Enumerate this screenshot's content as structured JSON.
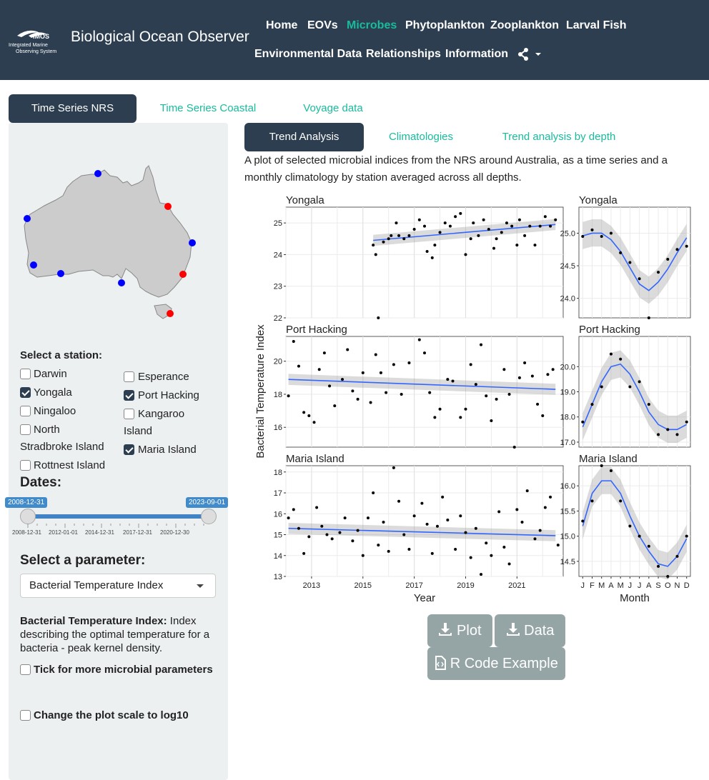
{
  "nav": {
    "brand": "Biological Ocean Observer",
    "logo_text": "IMOS",
    "logo_sub1": "Integrated Marine",
    "logo_sub2": "Observing System",
    "links": [
      "Home",
      "EOVs",
      "Microbes",
      "Phytoplankton",
      "Zooplankton",
      "Larval Fish",
      "Environmental Data",
      "Relationships",
      "Information"
    ],
    "active": "Microbes"
  },
  "top_tabs": [
    "Time Series NRS",
    "Time Series Coastal",
    "Voyage data"
  ],
  "sub_tabs": [
    "Trend Analysis",
    "Climatologies",
    "Trend analysis by depth"
  ],
  "description": "A plot of selected microbial indices from the NRS around Australia, as a time series and a monthly climatology by station averaged across all depths.",
  "sidebar": {
    "station_label": "Select a station:",
    "stations": [
      {
        "name": "Darwin",
        "checked": false
      },
      {
        "name": "Yongala",
        "checked": true
      },
      {
        "name": "Ningaloo",
        "checked": false
      },
      {
        "name": "North Stradbroke Island",
        "checked": false
      },
      {
        "name": "Rottnest Island",
        "checked": false
      },
      {
        "name": "Esperance",
        "checked": false
      },
      {
        "name": "Port Hacking",
        "checked": true
      },
      {
        "name": "Kangaroo Island",
        "checked": false
      },
      {
        "name": "Maria Island",
        "checked": true
      }
    ],
    "dates_label": "Dates:",
    "date_from": "2008-12-31",
    "date_to": "2023-09-01",
    "date_ticks": [
      "2008-12-31",
      "2012-01-01",
      "2014-12-31",
      "2017-12-31",
      "2020-12-30"
    ],
    "param_label": "Select a parameter:",
    "param_value": "Bacterial Temperature Index",
    "param_desc_term": "Bacterial Temperature Index:",
    "param_desc_text": " Index describing the optimal temperature for a bacteria - peak kernel density.",
    "tick_more_label": "Tick for more microbial parameters",
    "log_label": "Change the plot scale to log10"
  },
  "buttons": {
    "plot": "Plot",
    "data": "Data",
    "rcode": "R Code Example"
  },
  "colors": {
    "navbar": "#2c3e50",
    "accent": "#18bc9c",
    "trend": "#3366ff",
    "map_selected": "#ff0000",
    "map_unselected": "#0000ff"
  },
  "chart_data": [
    {
      "type": "scatter",
      "title": "Yongala",
      "xlabel": "Year",
      "ylabel": "Bacterial Temperature Index",
      "xlim": [
        2012,
        2022.8
      ],
      "ylim": [
        22,
        25.5
      ],
      "xticks": [
        2013,
        2015,
        2017,
        2019,
        2021
      ],
      "yticks": [
        22,
        23,
        24,
        25
      ],
      "points": [
        [
          2015.4,
          24.3
        ],
        [
          2015.5,
          24.0
        ],
        [
          2015.6,
          22.0
        ],
        [
          2015.8,
          24.4
        ],
        [
          2016.0,
          24.5
        ],
        [
          2016.1,
          24.6
        ],
        [
          2016.3,
          25.0
        ],
        [
          2016.4,
          24.6
        ],
        [
          2016.6,
          24.5
        ],
        [
          2016.8,
          24.6
        ],
        [
          2017.0,
          24.8
        ],
        [
          2017.2,
          25.1
        ],
        [
          2017.4,
          24.9
        ],
        [
          2017.5,
          24.1
        ],
        [
          2017.7,
          23.9
        ],
        [
          2017.8,
          24.3
        ],
        [
          2018.0,
          24.7
        ],
        [
          2018.2,
          25.0
        ],
        [
          2018.4,
          24.9
        ],
        [
          2018.6,
          25.2
        ],
        [
          2018.8,
          25.3
        ],
        [
          2019.0,
          24.0
        ],
        [
          2019.2,
          24.5
        ],
        [
          2019.3,
          25.0
        ],
        [
          2019.5,
          24.6
        ],
        [
          2019.7,
          25.1
        ],
        [
          2019.9,
          24.8
        ],
        [
          2020.1,
          24.2
        ],
        [
          2020.2,
          24.5
        ],
        [
          2020.4,
          24.7
        ],
        [
          2020.6,
          25.0
        ],
        [
          2020.8,
          24.9
        ],
        [
          2021.0,
          24.3
        ],
        [
          2021.1,
          25.1
        ],
        [
          2021.3,
          24.6
        ],
        [
          2021.5,
          24.9
        ],
        [
          2021.7,
          24.3
        ],
        [
          2021.9,
          24.9
        ],
        [
          2022.1,
          25.2
        ],
        [
          2022.3,
          24.9
        ],
        [
          2022.5,
          25.1
        ]
      ],
      "trend": [
        [
          2015.4,
          24.45
        ],
        [
          2022.5,
          24.95
        ]
      ]
    },
    {
      "type": "scatter",
      "title": "Port Hacking",
      "xlim": [
        2012,
        2022.8
      ],
      "ylim": [
        14.8,
        21.5
      ],
      "xticks": [
        2013,
        2015,
        2017,
        2019,
        2021
      ],
      "yticks": [
        16,
        18,
        20
      ],
      "points": [
        [
          2012.1,
          17.9
        ],
        [
          2012.3,
          21.2
        ],
        [
          2012.5,
          19.7
        ],
        [
          2012.7,
          16.9
        ],
        [
          2012.9,
          16.7
        ],
        [
          2013.1,
          16.3
        ],
        [
          2013.3,
          19.5
        ],
        [
          2013.5,
          20.5
        ],
        [
          2013.7,
          18.5
        ],
        [
          2013.9,
          17.3
        ],
        [
          2014.2,
          18.9
        ],
        [
          2014.4,
          20.7
        ],
        [
          2014.6,
          18.2
        ],
        [
          2014.8,
          17.7
        ],
        [
          2015.0,
          19.3
        ],
        [
          2015.3,
          17.5
        ],
        [
          2015.5,
          20.4
        ],
        [
          2015.7,
          19.3
        ],
        [
          2015.9,
          18.1
        ],
        [
          2016.2,
          19.8
        ],
        [
          2016.5,
          18.0
        ],
        [
          2016.8,
          19.9
        ],
        [
          2017.2,
          21.3
        ],
        [
          2017.4,
          20.5
        ],
        [
          2017.6,
          18.1
        ],
        [
          2017.8,
          16.6
        ],
        [
          2018.0,
          17.1
        ],
        [
          2018.3,
          18.9
        ],
        [
          2018.5,
          18.8
        ],
        [
          2018.8,
          16.6
        ],
        [
          2019.0,
          17.1
        ],
        [
          2019.2,
          19.8
        ],
        [
          2019.4,
          18.6
        ],
        [
          2019.6,
          21.0
        ],
        [
          2019.8,
          17.9
        ],
        [
          2020.0,
          16.4
        ],
        [
          2020.2,
          17.7
        ],
        [
          2020.5,
          19.5
        ],
        [
          2020.7,
          18.0
        ],
        [
          2020.9,
          14.8
        ],
        [
          2021.1,
          19.0
        ],
        [
          2021.3,
          19.9
        ],
        [
          2021.6,
          19.1
        ],
        [
          2021.8,
          17.4
        ],
        [
          2022.0,
          16.7
        ],
        [
          2022.2,
          19.2
        ],
        [
          2022.4,
          19.5
        ]
      ],
      "trend": [
        [
          2012.1,
          18.9
        ],
        [
          2022.5,
          18.3
        ]
      ]
    },
    {
      "type": "scatter",
      "title": "Maria Island",
      "xlim": [
        2012,
        2022.8
      ],
      "ylim": [
        13,
        18.3
      ],
      "xticks": [
        2013,
        2015,
        2017,
        2019,
        2021
      ],
      "yticks": [
        13,
        14,
        15,
        16,
        17,
        18
      ],
      "xticklabels": [
        "2013",
        "2015",
        "2017",
        "2019",
        "2021"
      ],
      "points": [
        [
          2012.1,
          15.8
        ],
        [
          2012.3,
          16.2
        ],
        [
          2012.5,
          15.3
        ],
        [
          2012.7,
          14.1
        ],
        [
          2012.9,
          14.9
        ],
        [
          2013.2,
          16.3
        ],
        [
          2013.4,
          15.4
        ],
        [
          2013.6,
          15.0
        ],
        [
          2013.8,
          14.8
        ],
        [
          2014.1,
          15.1
        ],
        [
          2014.3,
          15.8
        ],
        [
          2014.6,
          14.7
        ],
        [
          2014.8,
          15.2
        ],
        [
          2015.0,
          14.0
        ],
        [
          2015.2,
          15.8
        ],
        [
          2015.4,
          17.0
        ],
        [
          2015.6,
          14.5
        ],
        [
          2015.8,
          15.6
        ],
        [
          2016.0,
          14.2
        ],
        [
          2016.2,
          18.2
        ],
        [
          2016.4,
          16.6
        ],
        [
          2016.6,
          15.0
        ],
        [
          2016.8,
          14.3
        ],
        [
          2017.0,
          15.9
        ],
        [
          2017.3,
          16.5
        ],
        [
          2017.5,
          15.5
        ],
        [
          2017.7,
          14.1
        ],
        [
          2017.9,
          15.4
        ],
        [
          2018.1,
          16.8
        ],
        [
          2018.3,
          15.7
        ],
        [
          2018.6,
          14.3
        ],
        [
          2018.8,
          15.9
        ],
        [
          2019.0,
          15.1
        ],
        [
          2019.2,
          13.9
        ],
        [
          2019.4,
          15.3
        ],
        [
          2019.6,
          13.1
        ],
        [
          2019.8,
          14.6
        ],
        [
          2020.0,
          14.0
        ],
        [
          2020.3,
          16.1
        ],
        [
          2020.5,
          14.4
        ],
        [
          2020.7,
          13.6
        ],
        [
          2021.0,
          16.2
        ],
        [
          2021.2,
          15.6
        ],
        [
          2021.4,
          17.1
        ],
        [
          2021.7,
          14.8
        ],
        [
          2021.9,
          15.2
        ],
        [
          2022.1,
          16.3
        ],
        [
          2022.3,
          16.8
        ],
        [
          2022.6,
          14.5
        ]
      ],
      "trend": [
        [
          2012.1,
          15.3
        ],
        [
          2022.5,
          14.95
        ]
      ]
    },
    {
      "type": "line",
      "title": "Yongala",
      "xlabel": "Month",
      "xticklabels": [
        "J",
        "F",
        "M",
        "A",
        "M",
        "J",
        "J",
        "A",
        "S",
        "O",
        "N",
        "D"
      ],
      "ylim": [
        23.7,
        25.4
      ],
      "yticks": [
        24.0,
        24.5,
        25.0
      ],
      "points": [
        [
          1,
          24.95
        ],
        [
          2,
          25.05
        ],
        [
          3,
          24.95
        ],
        [
          4,
          25.0
        ],
        [
          5,
          24.7
        ],
        [
          6,
          24.55
        ],
        [
          7,
          24.3
        ],
        [
          8,
          23.7
        ],
        [
          9,
          24.4
        ],
        [
          10,
          24.6
        ],
        [
          11,
          24.75
        ],
        [
          12,
          24.8
        ]
      ],
      "smooth": [
        24.96,
        25.0,
        25.0,
        24.9,
        24.72,
        24.47,
        24.22,
        24.12,
        24.25,
        24.45,
        24.7,
        24.93
      ]
    },
    {
      "type": "line",
      "title": "Port Hacking",
      "ylim": [
        16.8,
        21.2
      ],
      "yticks": [
        17,
        18,
        19,
        20
      ],
      "points": [
        [
          1,
          17.8
        ],
        [
          2,
          18.5
        ],
        [
          3,
          19.2
        ],
        [
          4,
          20.5
        ],
        [
          5,
          20.3
        ],
        [
          6,
          19.2
        ],
        [
          7,
          19.4
        ],
        [
          8,
          18.5
        ],
        [
          9,
          17.3
        ],
        [
          10,
          17.5
        ],
        [
          11,
          17.3
        ],
        [
          12,
          17.8
        ]
      ],
      "smooth": [
        17.6,
        18.5,
        19.4,
        20.0,
        20.1,
        19.7,
        19.0,
        18.2,
        17.7,
        17.5,
        17.5,
        17.7
      ]
    },
    {
      "type": "line",
      "title": "Maria Island",
      "ylim": [
        14.2,
        16.4
      ],
      "yticks": [
        14.5,
        15.0,
        15.5,
        16.0
      ],
      "points": [
        [
          1,
          15.3
        ],
        [
          2,
          15.7
        ],
        [
          3,
          16.4
        ],
        [
          4,
          16.3
        ],
        [
          5,
          15.7
        ],
        [
          6,
          15.2
        ],
        [
          7,
          15.0
        ],
        [
          8,
          14.8
        ],
        [
          9,
          14.4
        ],
        [
          10,
          14.2
        ],
        [
          11,
          14.6
        ],
        [
          12,
          15.0
        ]
      ],
      "smooth": [
        15.2,
        15.85,
        16.1,
        16.1,
        15.85,
        15.4,
        15.0,
        14.7,
        14.45,
        14.4,
        14.6,
        14.95
      ]
    }
  ]
}
